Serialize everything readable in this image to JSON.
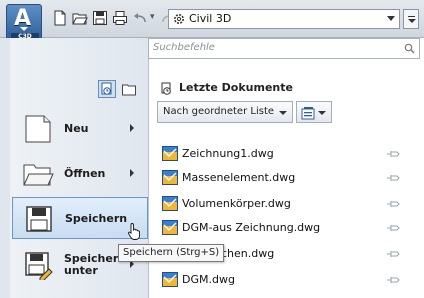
{
  "app": {
    "menu_badge": "C3D",
    "workspace": "Civil 3D"
  },
  "quick_access": [
    {
      "icon": "new-icon"
    },
    {
      "icon": "open-icon"
    },
    {
      "icon": "save-icon"
    },
    {
      "icon": "print-icon"
    },
    {
      "icon": "undo-icon"
    },
    {
      "icon": "redo-icon"
    }
  ],
  "search": {
    "placeholder": "Suchbefehle"
  },
  "menu": {
    "items": [
      {
        "label": "Neu",
        "icon": "new-document-icon",
        "has_submenu": true
      },
      {
        "label": "Öffnen",
        "icon": "open-folder-icon",
        "has_submenu": true
      },
      {
        "label": "Speichern",
        "icon": "save-disk-icon",
        "has_submenu": false
      },
      {
        "label": "Speichern unter",
        "icon": "save-as-icon",
        "has_submenu": true
      }
    ]
  },
  "tooltip": "Speichern (Strg+S)",
  "recent": {
    "heading": "Letzte Dokumente",
    "sort_label": "Nach geordneter Liste",
    "files": [
      {
        "name": "Zeichnung1.dwg"
      },
      {
        "name": "Massenelement.dwg"
      },
      {
        "name": "Volumenkörper.dwg"
      },
      {
        "name": "DGM-aus Zeichnung.dwg"
      },
      {
        "name": "Planzeichen.dwg"
      },
      {
        "name": "DGM.dwg"
      }
    ]
  },
  "colors": {
    "accent": "#2d5f9a",
    "selection": "#c8dcf2",
    "panel": "#dfe6ee"
  }
}
